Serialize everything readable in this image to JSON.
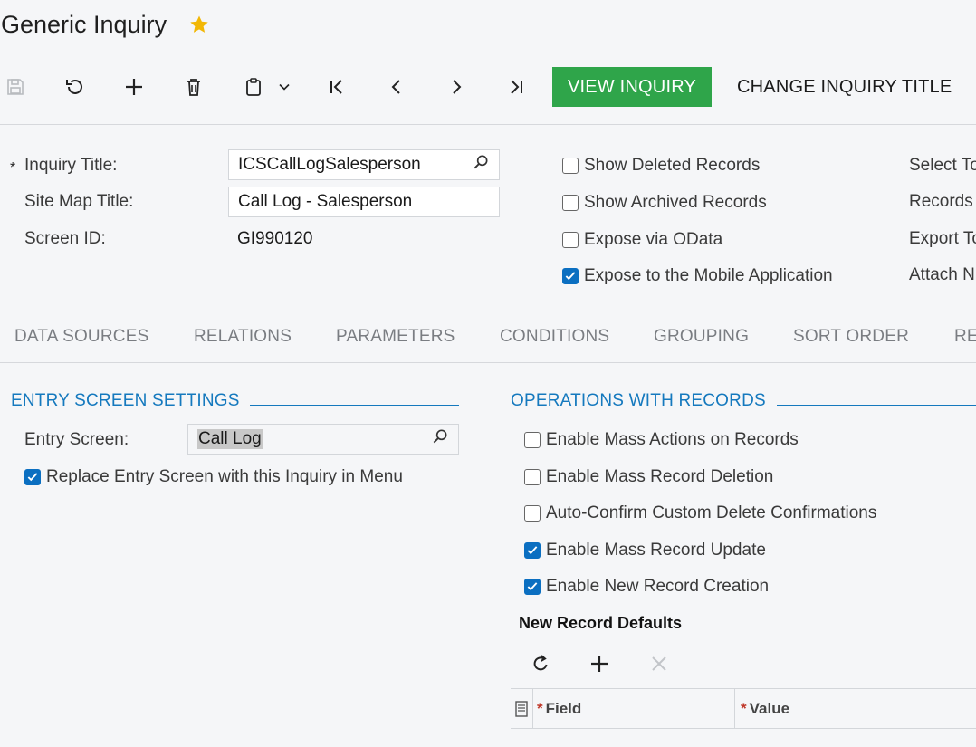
{
  "header": {
    "title": "Generic Inquiry",
    "star_icon": "star-icon"
  },
  "toolbar": {
    "icons": [
      "save-icon",
      "undo-icon",
      "add-icon",
      "delete-icon",
      "clipboard-icon",
      "chevron-down-icon",
      "first-record-icon",
      "previous-icon",
      "next-icon",
      "last-record-icon"
    ],
    "view_inquiry": "VIEW INQUIRY",
    "change_title": "CHANGE INQUIRY TITLE"
  },
  "form": {
    "required_mark": "*",
    "inquiry_title_label": "Inquiry Title:",
    "inquiry_title_value": "ICSCallLogSalesperson",
    "site_map_title_label": "Site Map Title:",
    "site_map_title_value": "Call Log - Salesperson",
    "screen_id_label": "Screen ID:",
    "screen_id_value": "GI990120",
    "options": [
      {
        "label": "Show Deleted Records",
        "checked": false
      },
      {
        "label": "Show Archived Records",
        "checked": false
      },
      {
        "label": "Expose via OData",
        "checked": false
      },
      {
        "label": "Expose to the Mobile Application",
        "checked": true
      }
    ],
    "right_labels": [
      "Select To",
      "Records",
      "Export To",
      "Attach N"
    ]
  },
  "tabs": [
    "DATA SOURCES",
    "RELATIONS",
    "PARAMETERS",
    "CONDITIONS",
    "GROUPING",
    "SORT ORDER",
    "RE"
  ],
  "entry_settings": {
    "title": "ENTRY SCREEN SETTINGS",
    "entry_screen_label": "Entry Screen:",
    "entry_screen_value": "Call Log",
    "replace_label": "Replace Entry Screen with this Inquiry in Menu",
    "replace_checked": true
  },
  "operations": {
    "title": "OPERATIONS WITH RECORDS",
    "items": [
      {
        "label": "Enable Mass Actions on Records",
        "checked": false
      },
      {
        "label": "Enable Mass Record Deletion",
        "checked": false
      },
      {
        "label": "Auto-Confirm Custom Delete Confirmations",
        "checked": false
      },
      {
        "label": "Enable Mass Record Update",
        "checked": true
      },
      {
        "label": "Enable New Record Creation",
        "checked": true
      }
    ],
    "defaults_title": "New Record Defaults",
    "grid_columns": [
      {
        "required": "*",
        "label": "Field"
      },
      {
        "required": "*",
        "label": "Value"
      }
    ]
  },
  "colors": {
    "accent": "#1579be",
    "primary_button": "#2fa54a",
    "checkbox_checked": "#0b6fc1",
    "star": "#f2b705"
  }
}
